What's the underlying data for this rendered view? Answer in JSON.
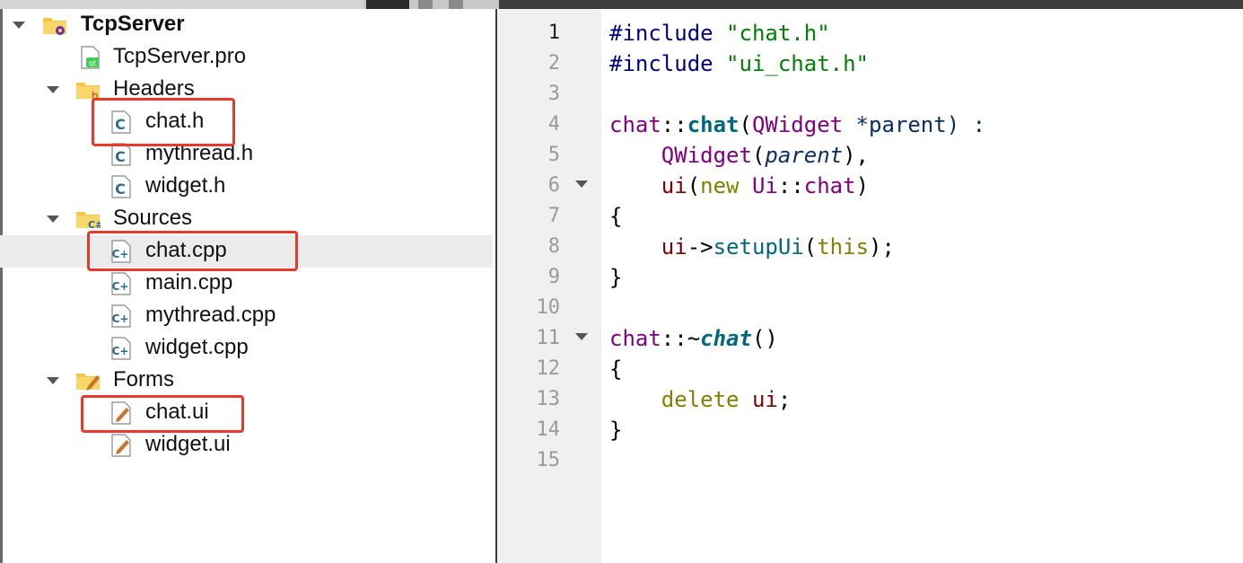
{
  "colors": {
    "highlight": "#e8392f",
    "gutter_bg": "#f0f0f0",
    "selected_row": "#ececec"
  },
  "tree": {
    "project": "TcpServer",
    "pro_file": "TcpServer.pro",
    "groups": {
      "headers": {
        "label": "Headers",
        "items": [
          "chat.h",
          "mythread.h",
          "widget.h"
        ]
      },
      "sources": {
        "label": "Sources",
        "items": [
          "chat.cpp",
          "main.cpp",
          "mythread.cpp",
          "widget.cpp"
        ]
      },
      "forms": {
        "label": "Forms",
        "items": [
          "chat.ui",
          "widget.ui"
        ]
      }
    },
    "icons": {
      "project": "qt-project-folder-icon",
      "pro": "qt-pro-file-icon",
      "headers": "headers-folder-icon",
      "sources": "sources-folder-icon",
      "forms": "forms-folder-icon",
      "header_file": "c-header-file-icon",
      "source_file": "cpp-source-file-icon",
      "form_file": "ui-form-file-icon"
    }
  },
  "editor": {
    "line_numbers": [
      "1",
      "2",
      "3",
      "4",
      "5",
      "6",
      "7",
      "8",
      "9",
      "10",
      "11",
      "12",
      "13",
      "14",
      "15"
    ],
    "current_line": "1",
    "lines": {
      "l1": {
        "a": "#include",
        "b": " ",
        "c": "\"chat.h\""
      },
      "l2": {
        "a": "#include",
        "b": " ",
        "c": "\"ui_chat.h\""
      },
      "l4": {
        "a": "chat",
        "b": "::",
        "c": "chat",
        "d": "(",
        "e": "QWidget",
        "f": " *parent) :"
      },
      "l5": {
        "a": "    ",
        "b": "QWidget",
        "c": "(",
        "d": "parent",
        "e": "),"
      },
      "l6": {
        "a": "    ",
        "b": "ui",
        "c": "(",
        "d": "new",
        "e": " ",
        "f": "Ui",
        "g": "::",
        "h": "chat",
        "i": ")"
      },
      "l7": {
        "a": "{"
      },
      "l8": {
        "a": "    ",
        "b": "ui",
        "c": "->",
        "d": "setupUi",
        "e": "(",
        "f": "this",
        "g": ");"
      },
      "l9": {
        "a": "}"
      },
      "l11": {
        "a": "chat",
        "b": "::~",
        "c": "chat",
        "d": "()"
      },
      "l12": {
        "a": "{"
      },
      "l13": {
        "a": "    ",
        "b": "delete",
        "c": " ",
        "d": "ui",
        "e": ";"
      },
      "l14": {
        "a": "}"
      }
    }
  }
}
